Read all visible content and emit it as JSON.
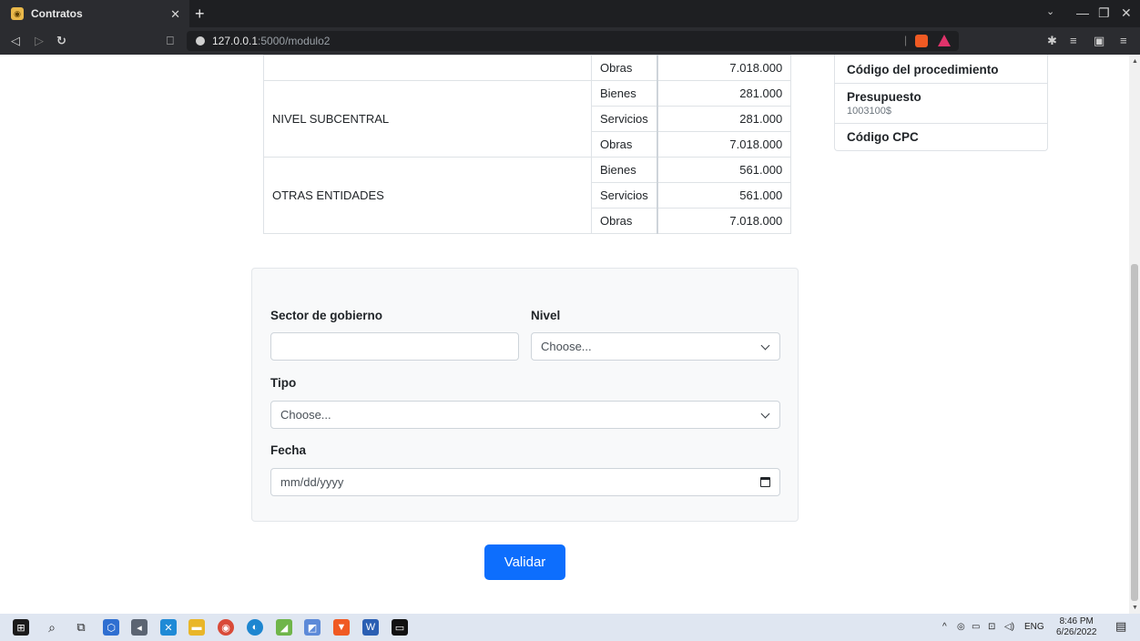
{
  "browser": {
    "tab_title": "Contratos",
    "url_host": "127.0.0.1",
    "url_path": ":5000/modulo2"
  },
  "table": {
    "rows": [
      {
        "category": "",
        "type": "Obras",
        "value": "7.018.000"
      },
      {
        "category": "NIVEL SUBCENTRAL",
        "type": "Bienes",
        "value": "281.000"
      },
      {
        "category": "",
        "type": "Servicios",
        "value": "281.000"
      },
      {
        "category": "",
        "type": "Obras",
        "value": "7.018.000"
      },
      {
        "category": "OTRAS ENTIDADES",
        "type": "Bienes",
        "value": "561.000"
      },
      {
        "category": "",
        "type": "Servicios",
        "value": "561.000"
      },
      {
        "category": "",
        "type": "Obras",
        "value": "7.018.000"
      }
    ]
  },
  "info": {
    "procedure_code_label": "Código del procedimiento",
    "budget_label": "Presupuesto",
    "budget_value": "1003100$",
    "cpc_label": "Código CPC"
  },
  "form": {
    "sector_label": "Sector de gobierno",
    "sector_value": "",
    "nivel_label": "Nivel",
    "nivel_selected": "Choose...",
    "tipo_label": "Tipo",
    "tipo_selected": "Choose...",
    "fecha_label": "Fecha",
    "fecha_placeholder": "mm/dd/yyyy",
    "submit_label": "Validar"
  },
  "taskbar": {
    "language": "ENG",
    "time": "8:46 PM",
    "date": "6/26/2022"
  },
  "colors": {
    "primary": "#0d6efd",
    "panel_bg": "#f8f9fa",
    "chrome_bg": "#2b2c30"
  }
}
